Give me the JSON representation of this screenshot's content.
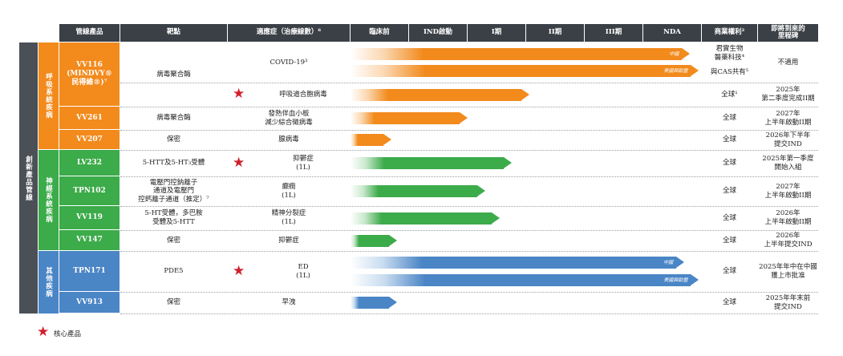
{
  "colors": {
    "header": "#3b4046",
    "orange": "#f28a1c",
    "green": "#3cab4a",
    "blue": "#4a85c6",
    "star": "#d0202e",
    "gray_band": "#4a5056"
  },
  "header": {
    "product": "管線產品",
    "target": "靶點",
    "indication": "適應症（治療線數）⁶",
    "preclinical": "臨床前",
    "ind": "IND啟動",
    "p1": "I期",
    "p2": "II期",
    "p3": "III期",
    "nda": "NDA",
    "rights": "商業權利²",
    "milestone": "即將到來的\n里程碑"
  },
  "outer_label": "創新產品管線",
  "groups": [
    {
      "label": "呼吸系統疾病",
      "color": "orange"
    },
    {
      "label": "神經系統疾病",
      "color": "green"
    },
    {
      "label": "其他疾病",
      "color": "blue"
    }
  ],
  "rows": [
    {
      "product": "VV116\n(MINDVY®\n民得維®)⁷",
      "target": "病毒聚合酶",
      "indication": "COVID-19³",
      "core": false,
      "bars": [
        {
          "label": "中國"
        },
        {
          "label": "美國與歐盟"
        }
      ],
      "rights": [
        "君實生物\n醫藥科技⁴",
        "與CAS共有⁵"
      ],
      "milestone": "不適用"
    },
    {
      "product": "",
      "target": "",
      "indication": "呼吸道合胞病毒",
      "core": true,
      "bars": [
        {
          "label": ""
        }
      ],
      "rights": [
        "全球¹"
      ],
      "milestone": "2025年\n第二季度完成II期"
    },
    {
      "product": "VV261",
      "target": "病毒聚合酶",
      "indication": "發熱伴血小板\n減少綜合徵病毒",
      "core": false,
      "bars": [
        {
          "label": ""
        }
      ],
      "rights": [
        "全球"
      ],
      "milestone": "2027年\n上半年啟動II期"
    },
    {
      "product": "VV207",
      "target": "保密",
      "indication": "腺病毒",
      "core": false,
      "bars": [
        {
          "label": ""
        }
      ],
      "rights": [
        "全球"
      ],
      "milestone": "2026年下半年\n提交IND"
    },
    {
      "product": "LV232",
      "target": "5-HTT及5-HT₃受體",
      "indication": "抑鬱症\n(1L)",
      "core": true,
      "bars": [
        {
          "label": ""
        }
      ],
      "rights": [
        "全球"
      ],
      "milestone": "2025年第一季度\n開始入組"
    },
    {
      "product": "TPN102",
      "target": "電壓門控鈉離子\n通道及電壓門\n控鈣離子通道（推定）⁷",
      "indication": "癲癇\n(1L)",
      "core": false,
      "bars": [
        {
          "label": ""
        }
      ],
      "rights": [
        "全球"
      ],
      "milestone": "2027年\n上半年啟動II期"
    },
    {
      "product": "VV119",
      "target": "5-HT受體，多巴胺\n受體及5-HTT",
      "indication": "精神分裂症\n(1L)",
      "core": false,
      "bars": [
        {
          "label": ""
        }
      ],
      "rights": [
        "全球"
      ],
      "milestone": "2026年\n上半年啟動II期"
    },
    {
      "product": "VV147",
      "target": "保密",
      "indication": "抑鬱症",
      "core": false,
      "bars": [
        {
          "label": ""
        }
      ],
      "rights": [
        "全球"
      ],
      "milestone": "2026年\n上半年提交IND"
    },
    {
      "product": "TPN171",
      "target": "PDE5",
      "indication": "ED\n(1L)",
      "core": true,
      "bars": [
        {
          "label": "中國"
        },
        {
          "label": "美國與歐盟"
        }
      ],
      "rights": [
        "全球"
      ],
      "milestone": "2025年年中在中國\n獲上市批准"
    },
    {
      "product": "VV913",
      "target": "保密",
      "indication": "早洩",
      "core": false,
      "bars": [
        {
          "label": ""
        }
      ],
      "rights": [
        "全球"
      ],
      "milestone": "2025年年末前\n提交IND"
    }
  ],
  "progress": {
    "scale": "0 = start of 臨床前, 6 = end of NDA",
    "rows": [
      [
        5.8,
        5.95
      ],
      [
        3.05
      ],
      [
        2.0
      ],
      [
        0.7
      ],
      [
        2.75
      ],
      [
        2.3
      ],
      [
        2.55
      ],
      [
        0.8
      ],
      [
        5.7,
        5.95
      ],
      [
        0.8
      ]
    ]
  },
  "legend": {
    "star_label": "核心產品"
  }
}
